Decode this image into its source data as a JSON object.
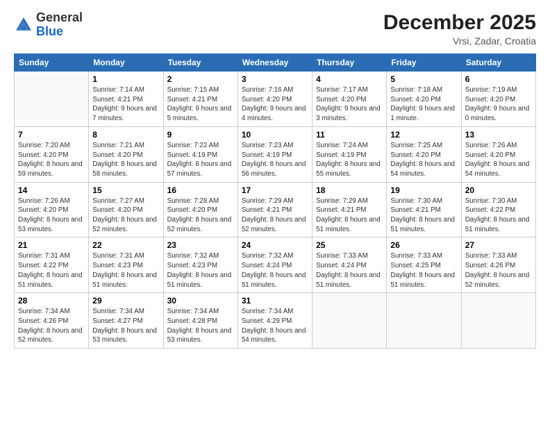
{
  "logo": {
    "general": "General",
    "blue": "Blue"
  },
  "header": {
    "month": "December 2025",
    "location": "Vrsi, Zadar, Croatia"
  },
  "columns": [
    "Sunday",
    "Monday",
    "Tuesday",
    "Wednesday",
    "Thursday",
    "Friday",
    "Saturday"
  ],
  "weeks": [
    [
      {
        "day": "",
        "sunrise": "",
        "sunset": "",
        "daylight": ""
      },
      {
        "day": "1",
        "sunrise": "Sunrise: 7:14 AM",
        "sunset": "Sunset: 4:21 PM",
        "daylight": "Daylight: 9 hours and 7 minutes."
      },
      {
        "day": "2",
        "sunrise": "Sunrise: 7:15 AM",
        "sunset": "Sunset: 4:21 PM",
        "daylight": "Daylight: 9 hours and 5 minutes."
      },
      {
        "day": "3",
        "sunrise": "Sunrise: 7:16 AM",
        "sunset": "Sunset: 4:20 PM",
        "daylight": "Daylight: 9 hours and 4 minutes."
      },
      {
        "day": "4",
        "sunrise": "Sunrise: 7:17 AM",
        "sunset": "Sunset: 4:20 PM",
        "daylight": "Daylight: 9 hours and 3 minutes."
      },
      {
        "day": "5",
        "sunrise": "Sunrise: 7:18 AM",
        "sunset": "Sunset: 4:20 PM",
        "daylight": "Daylight: 9 hours and 1 minute."
      },
      {
        "day": "6",
        "sunrise": "Sunrise: 7:19 AM",
        "sunset": "Sunset: 4:20 PM",
        "daylight": "Daylight: 9 hours and 0 minutes."
      }
    ],
    [
      {
        "day": "7",
        "sunrise": "Sunrise: 7:20 AM",
        "sunset": "Sunset: 4:20 PM",
        "daylight": "Daylight: 8 hours and 59 minutes."
      },
      {
        "day": "8",
        "sunrise": "Sunrise: 7:21 AM",
        "sunset": "Sunset: 4:20 PM",
        "daylight": "Daylight: 8 hours and 58 minutes."
      },
      {
        "day": "9",
        "sunrise": "Sunrise: 7:22 AM",
        "sunset": "Sunset: 4:19 PM",
        "daylight": "Daylight: 8 hours and 57 minutes."
      },
      {
        "day": "10",
        "sunrise": "Sunrise: 7:23 AM",
        "sunset": "Sunset: 4:19 PM",
        "daylight": "Daylight: 8 hours and 56 minutes."
      },
      {
        "day": "11",
        "sunrise": "Sunrise: 7:24 AM",
        "sunset": "Sunset: 4:19 PM",
        "daylight": "Daylight: 8 hours and 55 minutes."
      },
      {
        "day": "12",
        "sunrise": "Sunrise: 7:25 AM",
        "sunset": "Sunset: 4:20 PM",
        "daylight": "Daylight: 8 hours and 54 minutes."
      },
      {
        "day": "13",
        "sunrise": "Sunrise: 7:26 AM",
        "sunset": "Sunset: 4:20 PM",
        "daylight": "Daylight: 8 hours and 54 minutes."
      }
    ],
    [
      {
        "day": "14",
        "sunrise": "Sunrise: 7:26 AM",
        "sunset": "Sunset: 4:20 PM",
        "daylight": "Daylight: 8 hours and 53 minutes."
      },
      {
        "day": "15",
        "sunrise": "Sunrise: 7:27 AM",
        "sunset": "Sunset: 4:20 PM",
        "daylight": "Daylight: 8 hours and 52 minutes."
      },
      {
        "day": "16",
        "sunrise": "Sunrise: 7:28 AM",
        "sunset": "Sunset: 4:20 PM",
        "daylight": "Daylight: 8 hours and 52 minutes."
      },
      {
        "day": "17",
        "sunrise": "Sunrise: 7:29 AM",
        "sunset": "Sunset: 4:21 PM",
        "daylight": "Daylight: 8 hours and 52 minutes."
      },
      {
        "day": "18",
        "sunrise": "Sunrise: 7:29 AM",
        "sunset": "Sunset: 4:21 PM",
        "daylight": "Daylight: 8 hours and 51 minutes."
      },
      {
        "day": "19",
        "sunrise": "Sunrise: 7:30 AM",
        "sunset": "Sunset: 4:21 PM",
        "daylight": "Daylight: 8 hours and 51 minutes."
      },
      {
        "day": "20",
        "sunrise": "Sunrise: 7:30 AM",
        "sunset": "Sunset: 4:22 PM",
        "daylight": "Daylight: 8 hours and 51 minutes."
      }
    ],
    [
      {
        "day": "21",
        "sunrise": "Sunrise: 7:31 AM",
        "sunset": "Sunset: 4:22 PM",
        "daylight": "Daylight: 8 hours and 51 minutes."
      },
      {
        "day": "22",
        "sunrise": "Sunrise: 7:31 AM",
        "sunset": "Sunset: 4:23 PM",
        "daylight": "Daylight: 8 hours and 51 minutes."
      },
      {
        "day": "23",
        "sunrise": "Sunrise: 7:32 AM",
        "sunset": "Sunset: 4:23 PM",
        "daylight": "Daylight: 8 hours and 51 minutes."
      },
      {
        "day": "24",
        "sunrise": "Sunrise: 7:32 AM",
        "sunset": "Sunset: 4:24 PM",
        "daylight": "Daylight: 8 hours and 51 minutes."
      },
      {
        "day": "25",
        "sunrise": "Sunrise: 7:33 AM",
        "sunset": "Sunset: 4:24 PM",
        "daylight": "Daylight: 8 hours and 51 minutes."
      },
      {
        "day": "26",
        "sunrise": "Sunrise: 7:33 AM",
        "sunset": "Sunset: 4:25 PM",
        "daylight": "Daylight: 8 hours and 51 minutes."
      },
      {
        "day": "27",
        "sunrise": "Sunrise: 7:33 AM",
        "sunset": "Sunset: 4:26 PM",
        "daylight": "Daylight: 8 hours and 52 minutes."
      }
    ],
    [
      {
        "day": "28",
        "sunrise": "Sunrise: 7:34 AM",
        "sunset": "Sunset: 4:26 PM",
        "daylight": "Daylight: 8 hours and 52 minutes."
      },
      {
        "day": "29",
        "sunrise": "Sunrise: 7:34 AM",
        "sunset": "Sunset: 4:27 PM",
        "daylight": "Daylight: 8 hours and 53 minutes."
      },
      {
        "day": "30",
        "sunrise": "Sunrise: 7:34 AM",
        "sunset": "Sunset: 4:28 PM",
        "daylight": "Daylight: 8 hours and 53 minutes."
      },
      {
        "day": "31",
        "sunrise": "Sunrise: 7:34 AM",
        "sunset": "Sunset: 4:29 PM",
        "daylight": "Daylight: 8 hours and 54 minutes."
      },
      {
        "day": "",
        "sunrise": "",
        "sunset": "",
        "daylight": ""
      },
      {
        "day": "",
        "sunrise": "",
        "sunset": "",
        "daylight": ""
      },
      {
        "day": "",
        "sunrise": "",
        "sunset": "",
        "daylight": ""
      }
    ]
  ]
}
